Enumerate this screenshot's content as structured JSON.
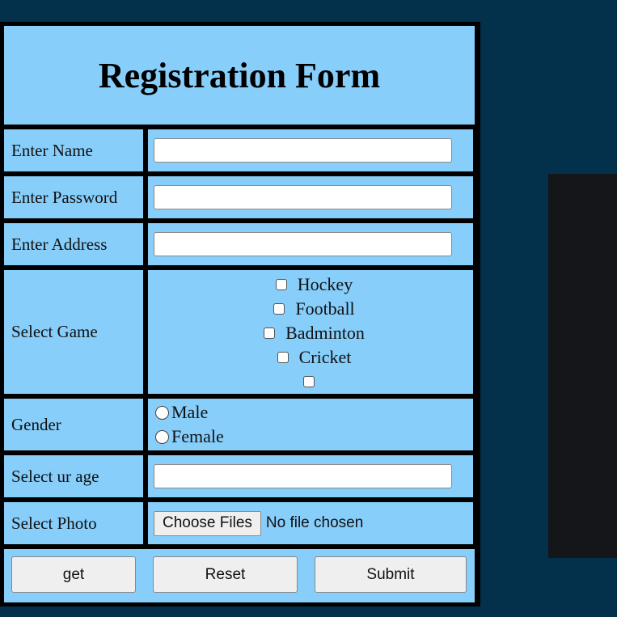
{
  "form": {
    "title": "Registration Form",
    "name_label": "Enter Name",
    "password_label": "Enter Password",
    "address_label": "Enter Address",
    "game_label": "Select Game",
    "games": [
      "Hockey",
      "Football",
      "Badminton",
      "Cricket",
      ""
    ],
    "gender_label": "Gender",
    "genders": [
      "Male",
      "Female"
    ],
    "age_label": "Select ur age",
    "photo_label": "Select Photo",
    "file_button": "Choose Files",
    "file_status": "No file chosen",
    "buttons": {
      "get": "get",
      "reset": "Reset",
      "submit": "Submit"
    }
  },
  "colors": {
    "page_background": "#03304a",
    "cell_background": "#87cefa",
    "table_border": "#000000"
  }
}
